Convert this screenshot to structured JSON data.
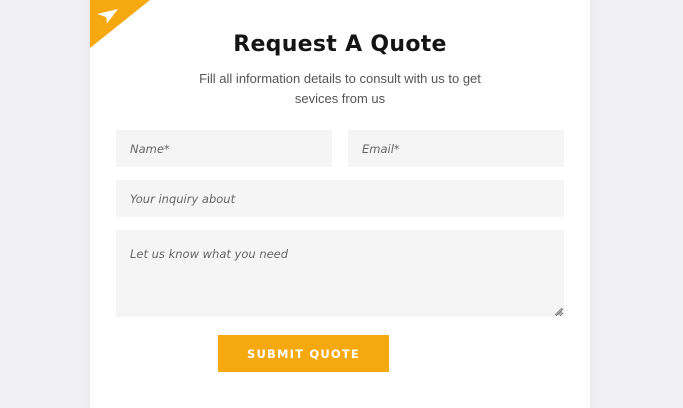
{
  "form": {
    "title": "Request A Quote",
    "subtitle": "Fill all information details to consult with us to get sevices from us",
    "name_placeholder": "Name*",
    "email_placeholder": "Email*",
    "inquiry_placeholder": "Your inquiry about",
    "message_placeholder": "Let us know what you need",
    "submit_label": "SUBMIT QUOTE"
  },
  "icons": {
    "corner": "paper-plane-icon"
  },
  "colors": {
    "accent": "#f6a80f",
    "field_background": "#f5f5f5",
    "page_background": "#f0f0f2",
    "title": "#141414"
  }
}
